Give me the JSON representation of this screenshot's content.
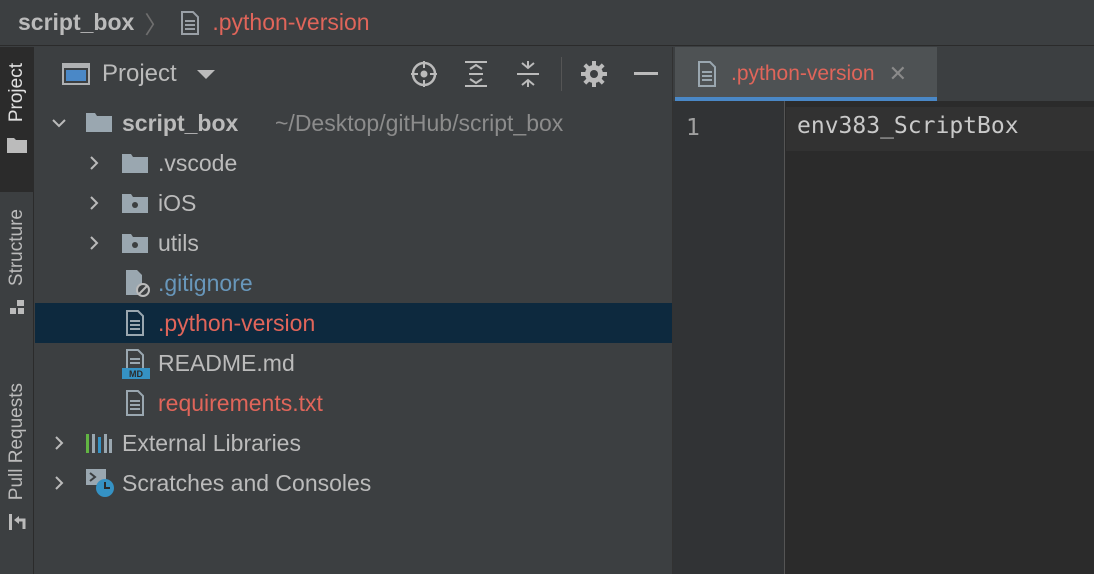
{
  "breadcrumb": {
    "project": "script_box",
    "file": ".python-version"
  },
  "tool_strip": {
    "tabs": [
      "Project",
      "Structure",
      "Pull Requests"
    ]
  },
  "project_panel": {
    "title": "Project",
    "tree": [
      {
        "label": "script_box",
        "path": "~/Desktop/gitHub/script_box",
        "kind": "root-folder",
        "expanded": true
      },
      {
        "label": ".vscode",
        "kind": "folder",
        "expanded": false
      },
      {
        "label": "iOS",
        "kind": "module-folder",
        "expanded": false
      },
      {
        "label": "utils",
        "kind": "module-folder",
        "expanded": false
      },
      {
        "label": ".gitignore",
        "kind": "ignore-file",
        "color": "#6897bb"
      },
      {
        "label": ".python-version",
        "kind": "text-file",
        "color": "#e0655a",
        "selected": true
      },
      {
        "label": "README.md",
        "kind": "markdown-file"
      },
      {
        "label": "requirements.txt",
        "kind": "text-file",
        "color": "#e0655a"
      },
      {
        "label": "External Libraries",
        "kind": "libraries",
        "expanded": false
      },
      {
        "label": "Scratches and Consoles",
        "kind": "scratches",
        "expanded": false
      }
    ]
  },
  "editor": {
    "tab_label": ".python-version",
    "line_number": "1",
    "code_line": "env383_ScriptBox"
  },
  "colors": {
    "accent": "#4a88c7",
    "modified_file": "#e0655a",
    "ignored_file": "#6897bb",
    "selection": "#0d293e"
  }
}
